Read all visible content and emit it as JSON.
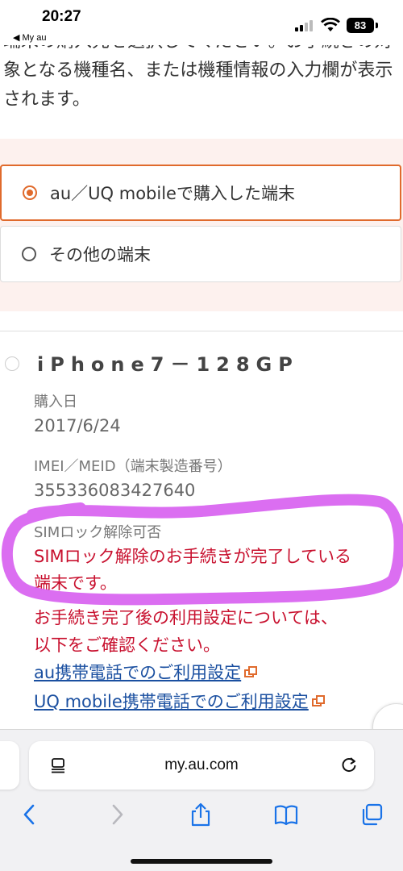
{
  "status_bar": {
    "time": "20:27",
    "back_app": "◀ My au",
    "battery": "83"
  },
  "intro": {
    "line1": "端末の購入先を選択してください。お手続きの対",
    "line2": "象となる機種名、または機種情報の入力欄が表示",
    "line3": "されます。"
  },
  "options": [
    {
      "label": "au／UQ mobileで購入した端末",
      "selected": true
    },
    {
      "label": "その他の端末",
      "selected": false
    }
  ],
  "device": {
    "name": "iPhone7－128GP",
    "purchase_date_label": "購入日",
    "purchase_date": "2017/6/24",
    "imei_label": "IMEI／MEID（端末製造番号）",
    "imei": "355336083427640",
    "sim_lock_label": "SIMロック解除可否",
    "sim_lock_status_1": "SIMロック解除のお手続きが完了している",
    "sim_lock_status_2": "端末です。",
    "note_1": "お手続き完了後の利用設定については、",
    "note_2": "以下をご確認ください。",
    "link_au": "au携帯電話でのご利用設定",
    "link_uq": "UQ mobile携帯電話でのご利用設定"
  },
  "browser": {
    "url": "my.au.com"
  },
  "colors": {
    "accent": "#e06a2c",
    "alert_red": "#c8102e",
    "link_blue": "#1a4fa0",
    "marker_purple": "#d966f0",
    "panel_bg": "#fdf1ee"
  },
  "icons": [
    "signal-icon",
    "wifi-icon",
    "battery-icon",
    "reader-icon",
    "reload-icon",
    "back-icon",
    "forward-icon",
    "share-icon",
    "bookmarks-icon",
    "tabs-icon",
    "external-link-icon"
  ]
}
